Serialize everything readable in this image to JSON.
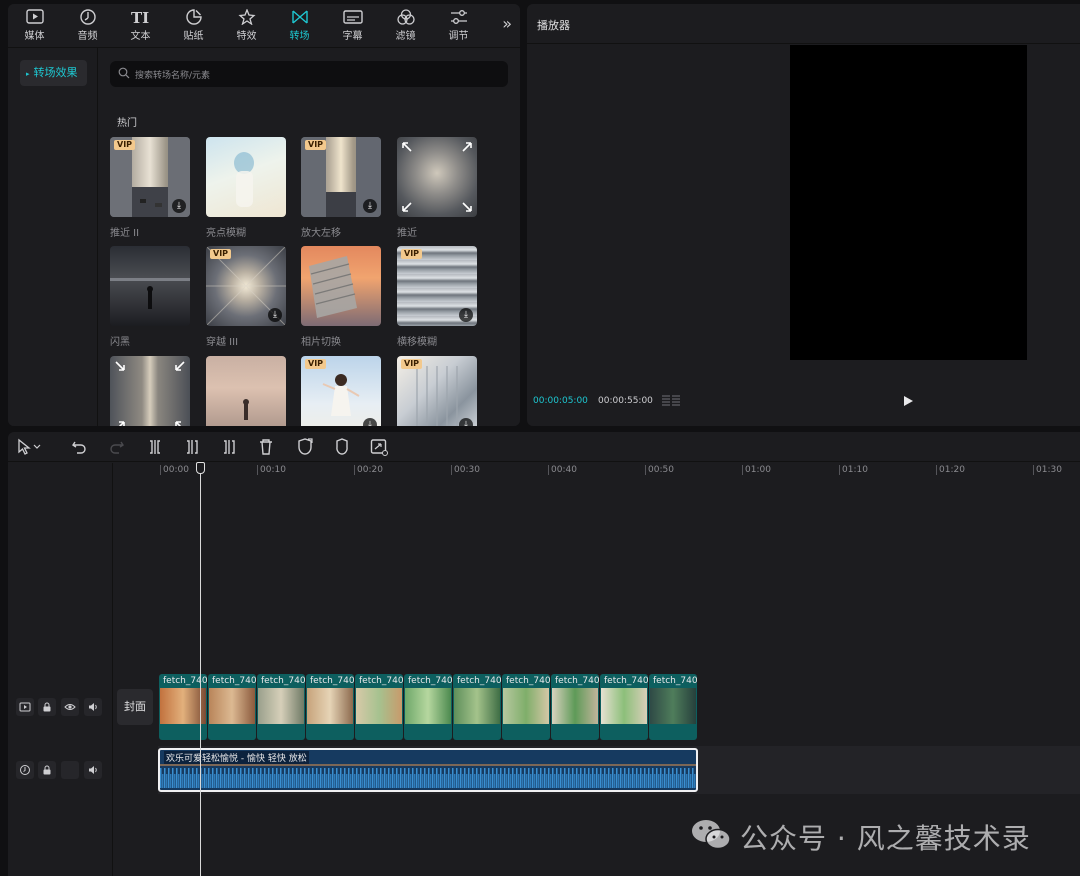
{
  "toolbar": {
    "items": [
      {
        "label": "媒体",
        "icon": "media-icon"
      },
      {
        "label": "音频",
        "icon": "audio-icon"
      },
      {
        "label": "文本",
        "icon": "text-icon"
      },
      {
        "label": "贴纸",
        "icon": "sticker-icon"
      },
      {
        "label": "特效",
        "icon": "effects-icon"
      },
      {
        "label": "转场",
        "icon": "transition-icon",
        "active": true
      },
      {
        "label": "字幕",
        "icon": "subtitle-icon"
      },
      {
        "label": "滤镜",
        "icon": "filter-icon"
      },
      {
        "label": "调节",
        "icon": "adjust-icon"
      }
    ],
    "more": "»"
  },
  "sidebar": {
    "active_category": "转场效果"
  },
  "search": {
    "placeholder": "搜索转场名称/元素"
  },
  "section_title": "热门",
  "transitions": [
    {
      "name": "推近 II",
      "vip": true,
      "download": true
    },
    {
      "name": "亮点模糊",
      "vip": false,
      "download": false
    },
    {
      "name": "放大左移",
      "vip": true,
      "download": true
    },
    {
      "name": "推近",
      "vip": false,
      "download": false
    },
    {
      "name": "闪黑",
      "vip": false,
      "download": false
    },
    {
      "name": "穿越 III",
      "vip": true,
      "download": true
    },
    {
      "name": "相片切换",
      "vip": false,
      "download": false
    },
    {
      "name": "横移模糊",
      "vip": true,
      "download": true
    },
    {
      "name": "",
      "vip": false,
      "download": false
    },
    {
      "name": "",
      "vip": false,
      "download": false
    },
    {
      "name": "",
      "vip": true,
      "download": true
    },
    {
      "name": "",
      "vip": true,
      "download": true
    }
  ],
  "vip_label": "VIP",
  "player": {
    "title": "播放器",
    "current_time": "00:00:05:00",
    "total_time": "00:00:55:00"
  },
  "timeline": {
    "ruler_labels": [
      "00:00",
      "00:10",
      "00:20",
      "00:30",
      "00:40",
      "00:50",
      "01:00",
      "01:10",
      "01:20",
      "01:30"
    ],
    "cover_label": "封面",
    "video_clips": [
      "fetch_740",
      "fetch_740",
      "fetch_740",
      "fetch_740",
      "fetch_740",
      "fetch_740",
      "fetch_740",
      "fetch_740",
      "fetch_740",
      "fetch_740",
      "fetch_740"
    ],
    "audio_clip": "欢乐可爱轻松愉悦 - 愉快 轻快 放松"
  },
  "watermark": "公众号 · 风之馨技术录",
  "colors": {
    "accent": "#1ec7d1",
    "panel": "#1c1c1f",
    "background": "#101012",
    "vip": "#f3c98d",
    "video_clip": "#0d5f5f",
    "audio_clip": "#163a60"
  }
}
